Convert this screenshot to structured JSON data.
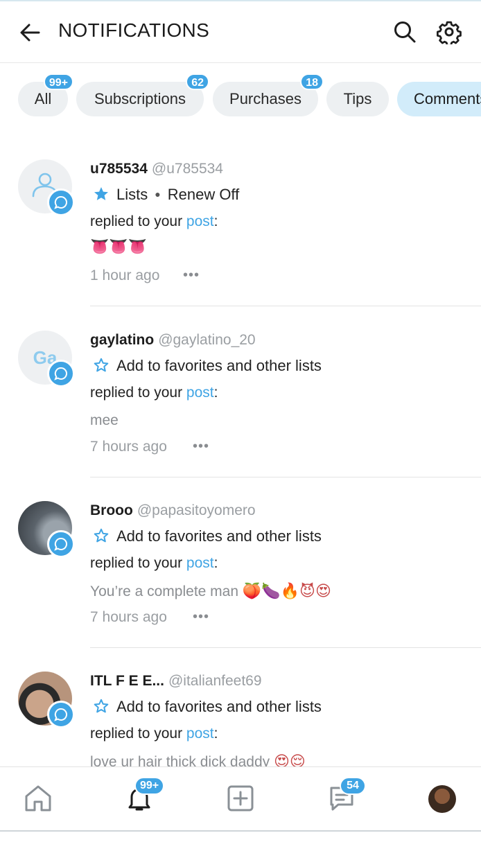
{
  "header": {
    "title": "NOTIFICATIONS"
  },
  "filters": [
    {
      "label": "All",
      "badge": "99+"
    },
    {
      "label": "Subscriptions",
      "badge": "62"
    },
    {
      "label": "Purchases",
      "badge": "18"
    },
    {
      "label": "Tips"
    },
    {
      "label": "Comments"
    }
  ],
  "notifications": [
    {
      "name": "u785534",
      "handle": "@u785534",
      "list_label": "Lists",
      "renew": "Renew Off",
      "action": "replied to your",
      "link": "post",
      "colon": ":",
      "content": "👅👅👅",
      "time": "1 hour ago",
      "more": "•••"
    },
    {
      "name": "gaylatino",
      "handle": "@gaylatino_20",
      "initials": "Ga",
      "list_label": "Add to favorites and other lists",
      "action": "replied to your",
      "link": "post",
      "colon": ":",
      "content": "mee",
      "time": "7 hours ago",
      "more": "•••"
    },
    {
      "name": "Brooo",
      "handle": "@papasitoyomero",
      "list_label": "Add to favorites and other lists",
      "action": "replied to your",
      "link": "post",
      "colon": ":",
      "content": "You’re a complete man",
      "content_emoji": "🍑🍆🔥😈😍",
      "time": "7 hours ago",
      "more": "•••"
    },
    {
      "name": "ITL F E E...",
      "handle": "@italianfeet69",
      "list_label": "Add to favorites and other lists",
      "action": "replied to your",
      "link": "post",
      "colon": ":",
      "content": "love ur hair thick dick daddy",
      "content_emoji": "😍😌"
    }
  ],
  "bottom_nav": {
    "notifications_badge": "99+",
    "messages_badge": "54"
  },
  "colors": {
    "accent": "#3fa4e4",
    "chip_bg": "#edf0f2",
    "chip_active_bg": "#d2ecfa"
  }
}
